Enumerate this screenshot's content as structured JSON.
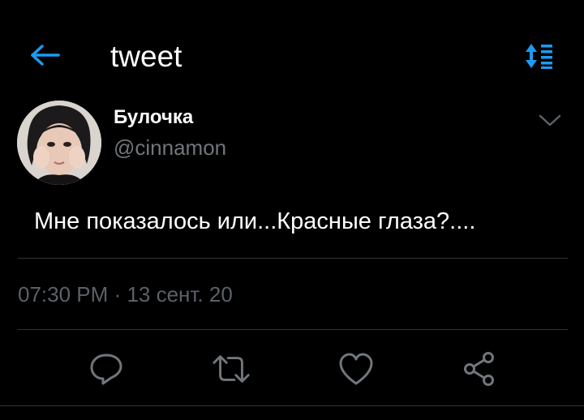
{
  "header": {
    "title": "tweet",
    "back_icon": "arrow-left-icon",
    "sort_icon": "sort-list-icon"
  },
  "tweet": {
    "display_name": "Булочка",
    "handle": "@cinnamon",
    "text": "Мне показалось или...Красные глаза?....",
    "time": "07:30 PM",
    "separator": "·",
    "date": "13 сент. 20"
  },
  "actions": {
    "reply_icon": "reply-icon",
    "retweet_icon": "retweet-icon",
    "like_icon": "heart-icon",
    "share_icon": "share-icon"
  },
  "colors": {
    "background": "#000000",
    "accent": "#1d9bf0",
    "primary_text": "#ffffff",
    "secondary_text": "#71767b",
    "divider": "#2f3336"
  }
}
